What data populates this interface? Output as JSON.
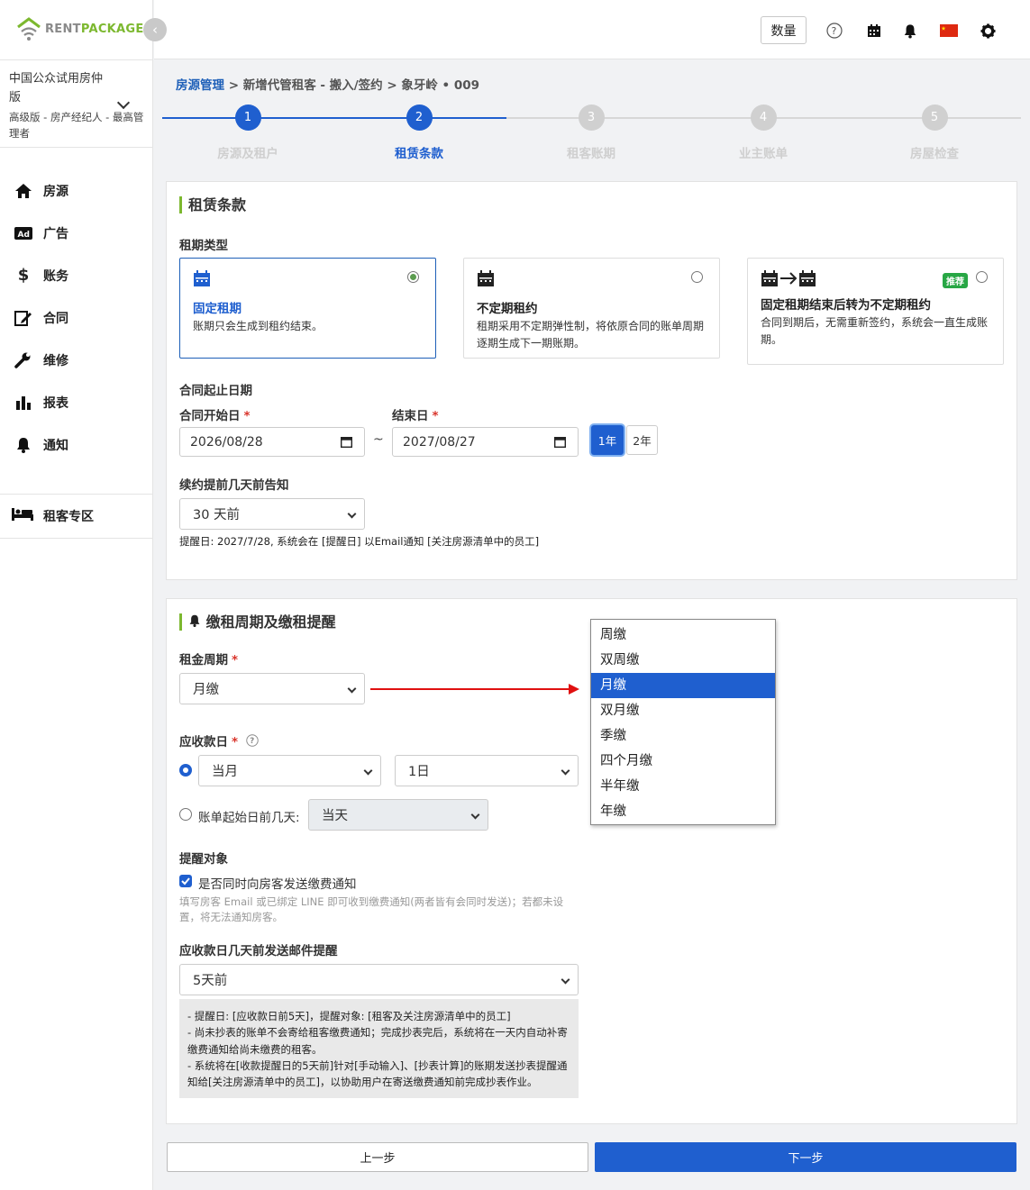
{
  "brand": {
    "part1": "RENT",
    "part2": "PACKAGE"
  },
  "account": {
    "name": "中国公众试用房仲版",
    "role": "高级版 - 房产经纪人 - 最高管理者"
  },
  "nav": [
    {
      "label": "房源",
      "icon": "home-icon"
    },
    {
      "label": "广告",
      "icon": "ad-icon"
    },
    {
      "label": "账务",
      "icon": "dollar-icon"
    },
    {
      "label": "合同",
      "icon": "contract-edit-icon"
    },
    {
      "label": "维修",
      "icon": "wrench-icon"
    },
    {
      "label": "报表",
      "icon": "bar-chart-icon"
    },
    {
      "label": "通知",
      "icon": "bell-icon"
    }
  ],
  "tenant_zone": "租客专区",
  "topbar": {
    "qty_label": "数量"
  },
  "breadcrumb": {
    "root": "房源管理",
    "rest": " > 新增代管租客 - 搬入/签约 > 象牙岭 • 009"
  },
  "steps": [
    {
      "num": "1",
      "label": "房源及租户",
      "state": "done"
    },
    {
      "num": "2",
      "label": "租赁条款",
      "state": "current"
    },
    {
      "num": "3",
      "label": "租客账期",
      "state": "todo"
    },
    {
      "num": "4",
      "label": "业主账单",
      "state": "todo"
    },
    {
      "num": "5",
      "label": "房屋检查",
      "state": "todo"
    }
  ],
  "lease": {
    "title": "租赁条款",
    "type_label": "租期类型",
    "options": [
      {
        "title": "固定租期",
        "desc": "账期只会生成到租约结束。",
        "selected": true
      },
      {
        "title": "不定期租约",
        "desc": "租期采用不定期弹性制，将依原合同的账单周期逐期生成下一期账期。",
        "selected": false
      },
      {
        "title": "固定租期结束后转为不定期租约",
        "desc": "合同到期后，无需重新签约，系统会一直生成账期。",
        "badge": "推荐",
        "selected": false
      }
    ],
    "period_label": "合同起止日期",
    "start_label": "合同开始日",
    "end_label": "结束日",
    "start_value": "2026/08/28",
    "end_value": "2027/08/27",
    "tilde": "~",
    "yr1": "1年",
    "yr2": "2年",
    "renew_label": "续约提前几天前告知",
    "renew_value": "30 天前",
    "renew_note": "提醒日: 2027/7/28, 系统会在 [提醒日] 以Email通知 [关注房源清单中的员工]"
  },
  "rent": {
    "title": "缴租周期及缴租提醒",
    "cycle_label": "租金周期",
    "cycle_value": "月缴",
    "cycle_options": [
      "周缴",
      "双周缴",
      "月缴",
      "双月缴",
      "季缴",
      "四个月缴",
      "半年缴",
      "年缴"
    ],
    "due_label": "应收款日",
    "due_month": "当月",
    "due_day": "1日",
    "before_label": "账单起始日前几天:",
    "before_value": "当天",
    "remind_label": "提醒对象",
    "remind_check": "是否同时向房客发送缴费通知",
    "remind_hint": "填写房客 Email 或已绑定 LINE 即可收到缴费通知(两者皆有会同时发送)；若都未设置，将无法通知房客。",
    "email_label": "应收款日几天前发送邮件提醒",
    "email_value": "5天前",
    "notes": [
      "- 提醒日: [应收款日前5天]，提醒对象: [租客及关注房源清单中的员工]",
      "- 尚未抄表的账单不会寄给租客缴费通知；完成抄表完后，系统将在一天内自动补寄缴费通知给尚未缴费的租客。",
      "- 系统将在[收款提醒日的5天前]针对[手动输入]、[抄表计算]的账期发送抄表提醒通知给[关注房源清单中的员工]，以协助用户在寄送缴费通知前完成抄表作业。"
    ]
  },
  "buttons": {
    "prev": "上一步",
    "next": "下一步"
  },
  "colors": {
    "primary": "#1f5fcf",
    "accent_green": "#7cb82f",
    "step_inactive": "#d0d0d0",
    "required": "#d9342b"
  }
}
